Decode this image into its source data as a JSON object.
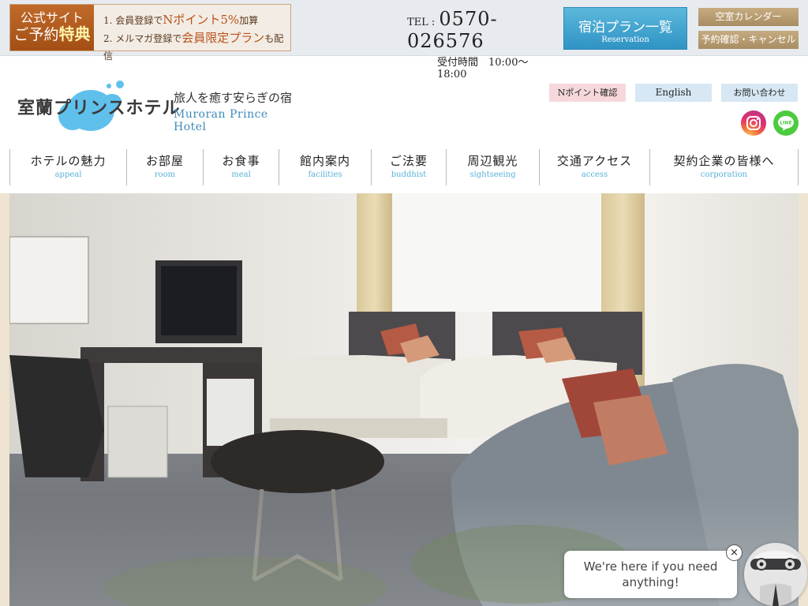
{
  "promo": {
    "badge_line1": "公式サイト",
    "badge_line2_a": "ご予約",
    "badge_line2_b": "特典",
    "item1_a": "1. 会員登録で",
    "item1_hl": "Nポイント5%",
    "item1_b": "加算",
    "item2_a": "2. メルマガ登録で",
    "item2_hl": "会員限定プラン",
    "item2_b": "も配信"
  },
  "contact": {
    "tel_label": "TEL :",
    "tel_number": "0570-026576",
    "hours": "受付時間　10:00〜18:00"
  },
  "top_buttons": {
    "plan_main": "宿泊プラン一覧",
    "plan_sub": "Reservation",
    "calendar": "空室カレンダー",
    "confirm": "予約確認・キャンセル"
  },
  "logo": {
    "name": "室蘭プリンスホテル",
    "tagline": "旅人を癒す安らぎの宿",
    "name_en": "Muroran Prince Hotel"
  },
  "utility": {
    "npoint": "Nポイント確認",
    "english": "English",
    "contact": "お問い合わせ"
  },
  "sns": [
    "instagram-icon",
    "line-icon"
  ],
  "nav": [
    {
      "jp": "ホテルの魅力",
      "en": "appeal"
    },
    {
      "jp": "お部屋",
      "en": "room"
    },
    {
      "jp": "お食事",
      "en": "meal"
    },
    {
      "jp": "館内案内",
      "en": "facilities"
    },
    {
      "jp": "ご法要",
      "en": "buddhist"
    },
    {
      "jp": "周辺観光",
      "en": "sightseeing"
    },
    {
      "jp": "交通アクセス",
      "en": "access"
    },
    {
      "jp": "契約企業の皆様へ",
      "en": "corporation"
    }
  ],
  "chat": {
    "message": "We're here if you need anything!",
    "close": "×"
  },
  "colors": {
    "accent_blue": "#2f93c4",
    "gold": "#a88d63",
    "promo_orange": "#b8531a",
    "nav_en": "#5ab2d8"
  }
}
